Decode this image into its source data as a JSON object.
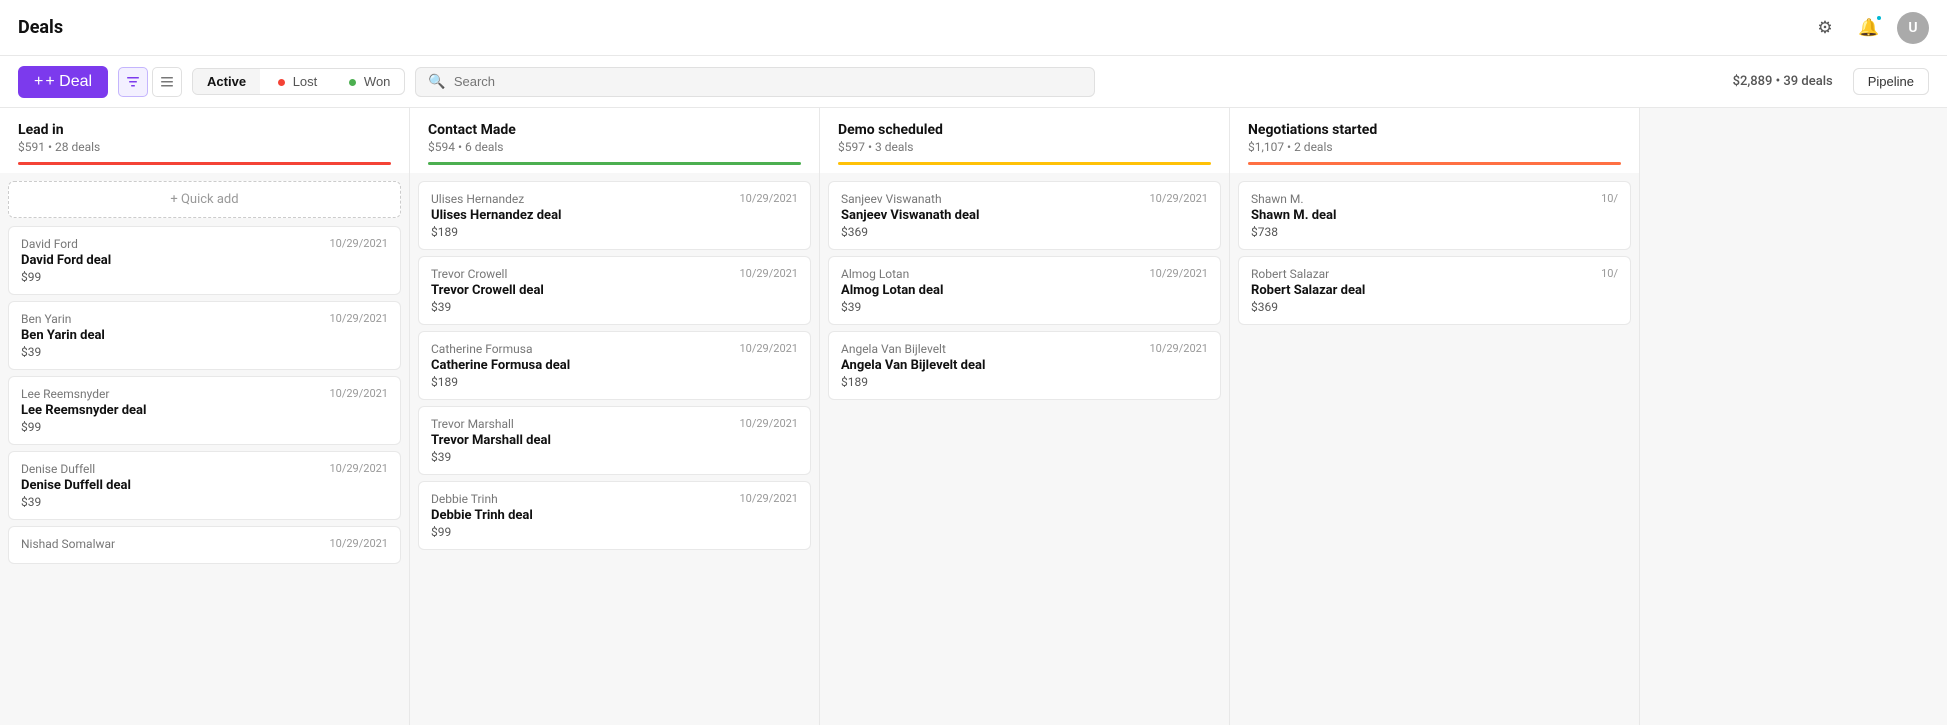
{
  "header": {
    "title": "Deals",
    "icons": {
      "settings": "⚙",
      "notification": "🔔",
      "avatar_label": "U"
    }
  },
  "toolbar": {
    "add_deal_label": "+ Deal",
    "view_icon_filter": "≡≡",
    "view_icon_list": "≡",
    "filter_active_label": "Active",
    "filter_lost_label": "Lost",
    "filter_won_label": "Won",
    "search_placeholder": "Search",
    "total_info": "$2,889 • 39 deals",
    "pipeline_label": "Pipeline"
  },
  "columns": [
    {
      "id": "lead_in",
      "title": "Lead in",
      "meta": "$591 • 28 deals",
      "bar_class": "bar-red",
      "quick_add_label": "+ Quick add",
      "cards": [
        {
          "contact": "David Ford",
          "date": "10/29/2021",
          "deal_name": "David Ford deal",
          "amount": "$99"
        },
        {
          "contact": "Ben Yarin",
          "date": "10/29/2021",
          "deal_name": "Ben Yarin deal",
          "amount": "$39"
        },
        {
          "contact": "Lee Reemsnyder",
          "date": "10/29/2021",
          "deal_name": "Lee Reemsnyder deal",
          "amount": "$99"
        },
        {
          "contact": "Denise Duffell",
          "date": "10/29/2021",
          "deal_name": "Denise Duffell deal",
          "amount": "$39"
        },
        {
          "contact": "Nishad Somalwar",
          "date": "10/29/2021",
          "deal_name": "",
          "amount": ""
        }
      ]
    },
    {
      "id": "contact_made",
      "title": "Contact Made",
      "meta": "$594 • 6 deals",
      "bar_class": "bar-green",
      "quick_add_label": "",
      "cards": [
        {
          "contact": "Ulises Hernandez",
          "date": "10/29/2021",
          "deal_name": "Ulises Hernandez deal",
          "amount": "$189"
        },
        {
          "contact": "Trevor Crowell",
          "date": "10/29/2021",
          "deal_name": "Trevor Crowell deal",
          "amount": "$39"
        },
        {
          "contact": "Catherine Formusa",
          "date": "10/29/2021",
          "deal_name": "Catherine Formusa deal",
          "amount": "$189"
        },
        {
          "contact": "Trevor Marshall",
          "date": "10/29/2021",
          "deal_name": "Trevor Marshall deal",
          "amount": "$39"
        },
        {
          "contact": "Debbie Trinh",
          "date": "10/29/2021",
          "deal_name": "Debbie Trinh deal",
          "amount": "$99"
        }
      ]
    },
    {
      "id": "demo_scheduled",
      "title": "Demo scheduled",
      "meta": "$597 • 3 deals",
      "bar_class": "bar-yellow",
      "quick_add_label": "",
      "cards": [
        {
          "contact": "Sanjeev Viswanath",
          "date": "10/29/2021",
          "deal_name": "Sanjeev Viswanath deal",
          "amount": "$369"
        },
        {
          "contact": "Almog Lotan",
          "date": "10/29/2021",
          "deal_name": "Almog Lotan deal",
          "amount": "$39"
        },
        {
          "contact": "Angela Van Bijlevelt",
          "date": "10/29/2021",
          "deal_name": "Angela Van Bijlevelt deal",
          "amount": "$189"
        }
      ]
    },
    {
      "id": "negotiations_started",
      "title": "Negotiations started",
      "meta": "$1,107 • 2 deals",
      "bar_class": "bar-orange",
      "quick_add_label": "",
      "cards": [
        {
          "contact": "Shawn M.",
          "date": "10/",
          "deal_name": "Shawn M. deal",
          "amount": "$738"
        },
        {
          "contact": "Robert Salazar",
          "date": "10/",
          "deal_name": "Robert Salazar deal",
          "amount": "$369"
        }
      ]
    }
  ]
}
